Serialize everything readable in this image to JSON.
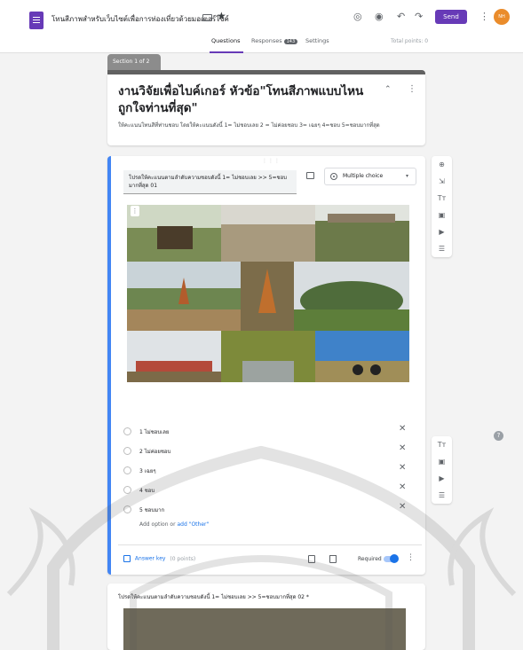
{
  "header": {
    "doc_title": "โทนสีภาพสำหรับเว็บไซต์เพื่อการท่องเที่ยวด้วยมอเตอร์ไซค์",
    "send_label": "Send",
    "avatar_initials": "NH",
    "total_points": "Total points: 0"
  },
  "tabs": [
    {
      "label": "Questions"
    },
    {
      "label": "Responses",
      "count": "143"
    },
    {
      "label": "Settings"
    }
  ],
  "section": {
    "label": "Section 1 of 2"
  },
  "form": {
    "title": "งานวิจัยเพื่อไบค์เกอร์ หัวข้อ\"โทนสีภาพแบบไหนถูกใจท่านที่สุด\"",
    "description": "ให้คะแนนโทนสีที่ท่านชอบ โดยให้คะแนนดังนี้ 1= ไม่ชอบเลย  2 = ไม่ค่อยชอบ  3= เฉยๆ  4=ชอบ  5=ชอบมากที่สุด"
  },
  "question": {
    "text": "โปรดให้คะแนนตามลำดับความชอบดังนี้ 1= ไม่ชอบเลย >> 5=ชอบมากที่สุด 01",
    "type": "Multiple choice",
    "options": [
      {
        "label": "1 ไม่ชอบเลย"
      },
      {
        "label": "2 ไม่ค่อยชอบ"
      },
      {
        "label": "3 เฉยๆ"
      },
      {
        "label": "4 ชอบ"
      },
      {
        "label": "5 ชอบมาก"
      }
    ],
    "add_option": "Add option",
    "add_option_or": "or",
    "add_other": "add \"Other\"",
    "answer_key": "Answer key",
    "points": "(0 points)",
    "required_label": "Required",
    "required": true
  },
  "question2": {
    "text": "โปรดให้คะแนนตามลำดับความชอบดังนี้ 1= ไม่ชอบเลย >> 5=ชอบมากที่สุด 02 *"
  },
  "toolbar_icons": [
    "add-question-icon",
    "import-questions-icon",
    "add-title-icon",
    "add-image-icon",
    "add-video-icon",
    "add-section-icon"
  ],
  "colors": {
    "accent": "#673ab7",
    "active_question": "#4285f4",
    "link": "#1a73e8"
  }
}
